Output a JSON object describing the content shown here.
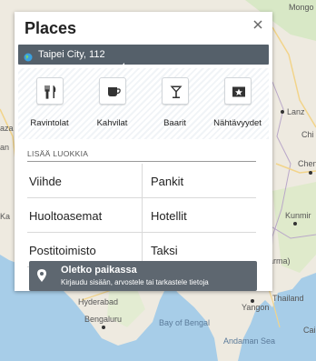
{
  "map": {
    "labels": {
      "mongolia": "Mongo",
      "lanz": "Lanz",
      "chi": "Chi",
      "chen": "Chen",
      "kunmir": "Kunmir",
      "arma": "arma)",
      "thailand": "Thailand",
      "cai": "Cai",
      "yangon": "Yangon",
      "hyderabad": "Hyderabad",
      "bengaluru": "Bengaluru",
      "bay_of_bengal": "Bay of Bengal",
      "andaman_sea": "Andaman Sea",
      "aza": "aza",
      "an": "an",
      "ka": "Ka"
    },
    "colors": {
      "land": "#eeeae0",
      "water": "#a7cde8",
      "green": "#d8e8c6",
      "road": "#f2d48a"
    }
  },
  "panel": {
    "title": "Places",
    "close_icon": "close-icon",
    "location": {
      "icon": "globe-icon",
      "text": "Taipei City, 112"
    },
    "categories": [
      {
        "icon": "restaurant-icon",
        "label": "Ravintolat"
      },
      {
        "icon": "cafe-icon",
        "label": "Kahvilat"
      },
      {
        "icon": "bar-icon",
        "label": "Baarit"
      },
      {
        "icon": "attractions-icon",
        "label": "Nähtävyydet"
      }
    ],
    "more": {
      "header": "LISÄÄ LUOKKIA",
      "rows": [
        [
          "Viihde",
          "Pankit"
        ],
        [
          "Huoltoasemat",
          "Hotellit"
        ],
        [
          "Postitoimisto",
          "Taksi"
        ]
      ]
    },
    "colors": {
      "location_bar": "#55606a",
      "banner": "#5e6770"
    }
  },
  "banner": {
    "icon": "location-pin-icon",
    "title": "Oletko paikassa",
    "subtitle": "Kirjaudu sisään, arvostele tai tarkastele tietoja"
  }
}
